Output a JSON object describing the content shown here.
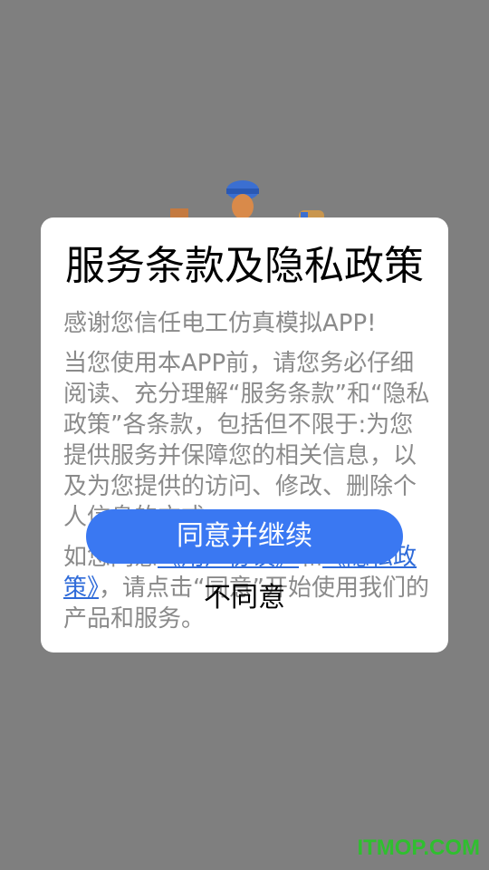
{
  "dialog": {
    "title": "服务条款及隐私政策",
    "thanks": "感谢您信任电工仿真模拟APP!",
    "paragraph": "当您使用本APP前，请您务必仔细阅读、充分理解“服务条款”和“隐私政策”各条款，包括但不限于:为您提供服务并保障您的相关信息，以及为您提供的访问、修改、删除个人信息的方式。",
    "consent_prefix": "如您同意",
    "user_agreement_link": "《用户协议》",
    "consent_and": "和",
    "privacy_policy_link": "《隐私政策》",
    "consent_suffix": "，请点击“同意”开始使用我们的产品和服务。",
    "agree_button": "同意并继续",
    "disagree_button": "不同意"
  },
  "watermark": "ITMOP.COM",
  "colors": {
    "overlay": "#7f7f7f",
    "accent": "#3a78f2",
    "link": "#2f6bd9",
    "watermark": "#2fbf2f"
  }
}
